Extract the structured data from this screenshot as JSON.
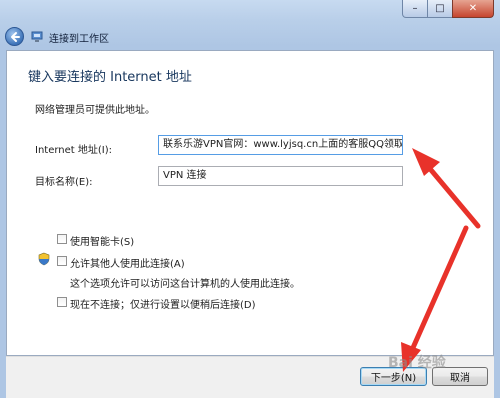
{
  "window": {
    "title": "连接到工作区",
    "controls": {
      "minimize": "–",
      "maximize": "□",
      "close": "✕"
    }
  },
  "page": {
    "heading": "键入要连接的 Internet 地址",
    "info": "网络管理员可提供此地址。",
    "internet_address": {
      "label": "Internet 地址(I):",
      "value": "联系乐游VPN官网：www.lyjsq.cn上面的客服QQ领取"
    },
    "destination_name": {
      "label": "目标名称(E):",
      "value": "VPN 连接"
    },
    "options": {
      "smart_card": {
        "label": "使用智能卡(S)",
        "checked": false
      },
      "allow_others": {
        "label": "允许其他人使用此连接(A)",
        "checked": false,
        "note": "这个选项允许可以访问这台计算机的人使用此连接。"
      },
      "dont_connect": {
        "label": "现在不连接；仅进行设置以便稍后连接(D)",
        "checked": false
      }
    }
  },
  "buttons": {
    "next": "下一步(N)",
    "cancel": "取消"
  },
  "overlay": {
    "arrow_color": "#e8322a",
    "watermark": "Bai 经验"
  },
  "colors": {
    "accent": "#17365d",
    "frame": "#b9cfe9"
  }
}
